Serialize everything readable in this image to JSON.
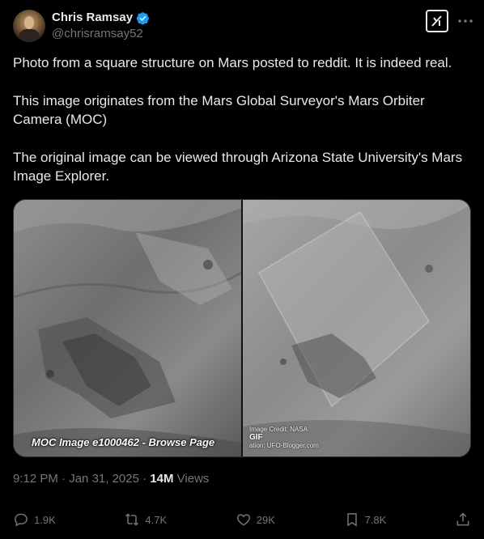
{
  "author": {
    "display_name": "Chris Ramsay",
    "handle": "@chrisramsay52",
    "verified": true
  },
  "header_actions": {
    "grok_icon": "grok-icon",
    "more_icon": "more-horizontal-icon"
  },
  "tweet": {
    "paragraphs": [
      "Photo from a square structure on Mars posted to reddit. It is indeed real.",
      "This image originates from the Mars Global Surveyor's Mars Orbiter Camera (MOC)",
      "The original image can be viewed through Arizona State University's Mars Image Explorer."
    ]
  },
  "media": {
    "left_caption": "MOC Image e1000462 - Browse Page",
    "credit_line1": "Image Credit: NASA",
    "gif_label": "GIF",
    "credit_line2": "ation: UFO-Blogger.com"
  },
  "meta": {
    "time": "9:12 PM",
    "date": "Jan 31, 2025",
    "views_count": "14M",
    "views_label": "Views"
  },
  "actions": {
    "replies": "1.9K",
    "reposts": "4.7K",
    "likes": "29K",
    "bookmarks": "7.8K"
  },
  "colors": {
    "background": "#000000",
    "text": "#e7e9ea",
    "muted": "#71767b",
    "verified": "#1d9bf0"
  }
}
